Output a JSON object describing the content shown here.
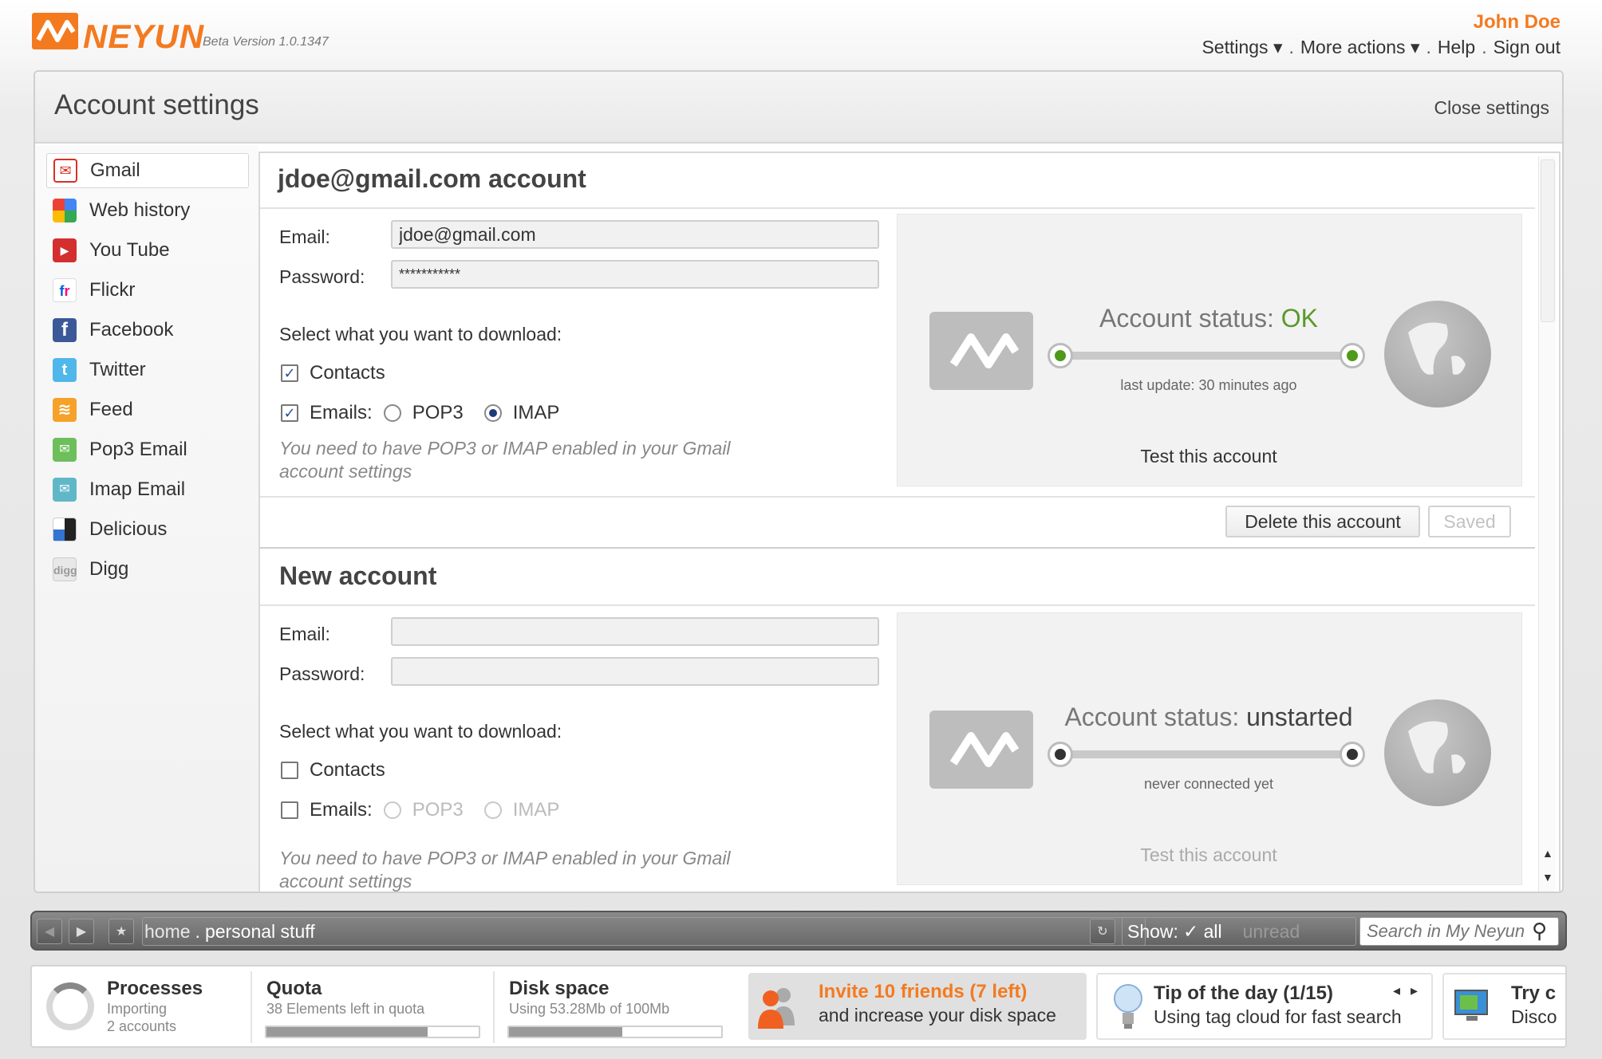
{
  "app": {
    "logo_text": "NEYUN",
    "version": "Beta Version 1.0.1347",
    "user": "John Doe",
    "menu": {
      "settings": "Settings ▾",
      "more_actions": "More actions ▾",
      "help": "Help",
      "sign_out": "Sign out",
      "separator": "."
    }
  },
  "panel": {
    "title": "Account settings",
    "close": "Close settings"
  },
  "sidebar": {
    "items": [
      {
        "label": "Gmail",
        "icon": "gmail-icon",
        "color": "#d93025",
        "glyph": "✉"
      },
      {
        "label": "Web history",
        "icon": "web-history-icon",
        "color": "#4caf50",
        "glyph": "☉"
      },
      {
        "label": "You Tube",
        "icon": "youtube-icon",
        "color": "#d32f2f",
        "glyph": "▶"
      },
      {
        "label": "Flickr",
        "icon": "flickr-icon",
        "color": "#ffffff",
        "glyph": "fr"
      },
      {
        "label": "Facebook",
        "icon": "facebook-icon",
        "color": "#3b5998",
        "glyph": "f"
      },
      {
        "label": "Twitter",
        "icon": "twitter-icon",
        "color": "#4fb7ea",
        "glyph": "t"
      },
      {
        "label": "Feed",
        "icon": "feed-icon",
        "color": "#f6a22a",
        "glyph": "≡"
      },
      {
        "label": "Pop3 Email",
        "icon": "pop3-email-icon",
        "color": "#6cbf5a",
        "glyph": "✉"
      },
      {
        "label": "Imap Email",
        "icon": "imap-email-icon",
        "color": "#5fb7c8",
        "glyph": "✉"
      },
      {
        "label": "Delicious",
        "icon": "delicious-icon",
        "color": "#3274d1",
        "glyph": ""
      },
      {
        "label": "Digg",
        "icon": "digg-icon",
        "color": "#cccccc",
        "glyph": "d"
      }
    ]
  },
  "account1": {
    "title": "jdoe@gmail.com account",
    "email_label": "Email:",
    "email_value": "jdoe@gmail.com",
    "password_label": "Password:",
    "password_value": "***********",
    "download_prompt": "Select what you want to download:",
    "contacts_label": "Contacts",
    "emails_label": "Emails:",
    "pop3_label": "POP3",
    "imap_label": "IMAP",
    "hint": "You need to have POP3 or IMAP enabled in your Gmail account settings",
    "status_label": "Account status:",
    "status_value": "OK",
    "last_update": "last update: 30 minutes ago",
    "test": "Test this account",
    "delete": "Delete this account",
    "saved": "Saved"
  },
  "account2": {
    "title": "New account",
    "email_label": "Email:",
    "email_value": "",
    "password_label": "Password:",
    "password_value": "",
    "download_prompt": "Select what you want to download:",
    "contacts_label": "Contacts",
    "emails_label": "Emails:",
    "pop3_label": "POP3",
    "imap_label": "IMAP",
    "hint": "You need to have POP3 or IMAP enabled in your Gmail account settings",
    "status_label": "Account status:",
    "status_value": "unstarted",
    "last_update": "never connected yet",
    "test": "Test this account"
  },
  "navbar": {
    "back": "◀",
    "forward": "▶",
    "star": "★",
    "crumb_home": "home",
    "crumb_sep": ".",
    "crumb_current": "personal stuff",
    "refresh": "↻",
    "show_label": "Show:",
    "show_all": "✓ all",
    "show_unread": "unread",
    "search_placeholder": "Search in My Neyun",
    "search_icon": "⚲"
  },
  "widgets": {
    "processes_title": "Processes",
    "processes_line1": "Importing",
    "processes_line2": "2 accounts",
    "quota_title": "Quota",
    "quota_sub": "38 Elements left in quota",
    "quota_fill": 0.76,
    "disk_title": "Disk space",
    "disk_sub": "Using 53.28Mb of 100Mb",
    "disk_fill": 0.5328,
    "invite_title": "Invite 10 friends (7 left)",
    "invite_sub": "and increase your disk space",
    "tip_title": "Tip of the day (1/15)",
    "tip_sub": "Using tag cloud for fast search",
    "tip_prev": "◂",
    "tip_next": "▸",
    "try_title": "Try c",
    "try_sub": "Disco"
  },
  "colors": {
    "accent": "#f47a20",
    "status_ok": "#5a9a2a",
    "knob_active": "#4e9a1a",
    "knob_idle": "#333333"
  }
}
